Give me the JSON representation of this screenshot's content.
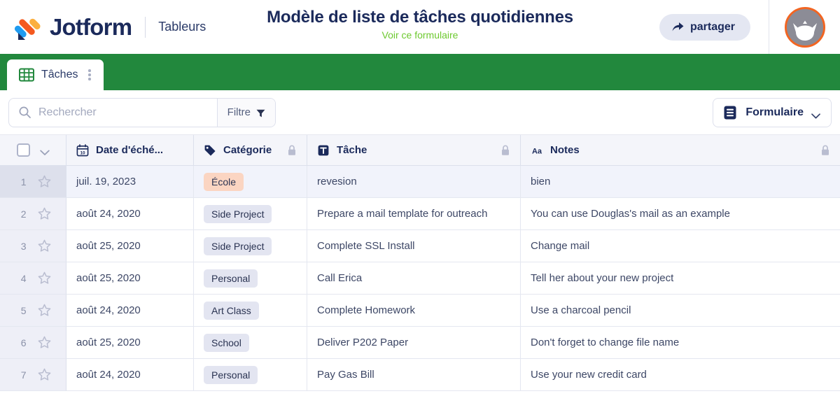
{
  "header": {
    "logo_icon": "jotform-logo-icon",
    "brand": "Jotform",
    "product": "Tableurs",
    "title": "Modèle de liste de tâches quotidiennes",
    "subtitle_link": "Voir ce formulaire",
    "share_label": "partager",
    "share_icon": "share-arrow-icon",
    "avatar_icon": "user-avatar-icon",
    "colors": {
      "brand_navy": "#1B2A5B",
      "link_green": "#6DC92F",
      "tabbar_green": "#22883D",
      "avatar_ring_orange": "#F26522"
    }
  },
  "tabs": [
    {
      "label": "Tâches",
      "icon": "grid-table-icon",
      "menu_icon": "more-vertical-icon",
      "active": true
    }
  ],
  "toolbar": {
    "search": {
      "placeholder": "Rechercher",
      "value": "",
      "icon": "search-icon"
    },
    "filter": {
      "label": "Filtre",
      "icon": "funnel-icon"
    },
    "form_button": {
      "label": "Formulaire",
      "icon": "form-document-icon",
      "chevron": "chevron-down-icon"
    }
  },
  "table": {
    "gutter_header": {
      "checkbox_icon": "checkbox-unchecked-icon",
      "chevron_icon": "chevron-down-icon"
    },
    "columns": [
      {
        "key": "date",
        "label": "Date d'éché...",
        "icon": "calendar-icon",
        "locked": false
      },
      {
        "key": "cat",
        "label": "Catégorie",
        "icon": "tag-icon",
        "locked": true
      },
      {
        "key": "task",
        "label": "Tâche",
        "icon": "text-field-icon",
        "locked": true
      },
      {
        "key": "notes",
        "label": "Notes",
        "icon": "aa-text-icon",
        "locked": true
      }
    ],
    "rows": [
      {
        "num": "1",
        "date": "juil. 19, 2023",
        "category": "École",
        "category_color": "peach",
        "task": "revesion",
        "notes": "bien",
        "selected": true
      },
      {
        "num": "2",
        "date": "août 24, 2020",
        "category": "Side Project",
        "category_color": "grey",
        "task": "Prepare a mail template for outreach",
        "notes": "You can use Douglas's mail as an example",
        "selected": false
      },
      {
        "num": "3",
        "date": "août 25, 2020",
        "category": "Side Project",
        "category_color": "grey",
        "task": "Complete SSL Install",
        "notes": "Change mail",
        "selected": false
      },
      {
        "num": "4",
        "date": "août 25, 2020",
        "category": "Personal",
        "category_color": "grey",
        "task": "Call Erica",
        "notes": "Tell her about your new project",
        "selected": false
      },
      {
        "num": "5",
        "date": "août 24, 2020",
        "category": "Art Class",
        "category_color": "grey",
        "task": "Complete Homework",
        "notes": "Use a charcoal pencil",
        "selected": false
      },
      {
        "num": "6",
        "date": "août 25, 2020",
        "category": "School",
        "category_color": "grey",
        "task": "Deliver P202 Paper",
        "notes": "Don't forget to change file name",
        "selected": false
      },
      {
        "num": "7",
        "date": "août 24, 2020",
        "category": "Personal",
        "category_color": "grey",
        "task": "Pay Gas Bill",
        "notes": "Use your new credit card",
        "selected": false
      }
    ]
  }
}
